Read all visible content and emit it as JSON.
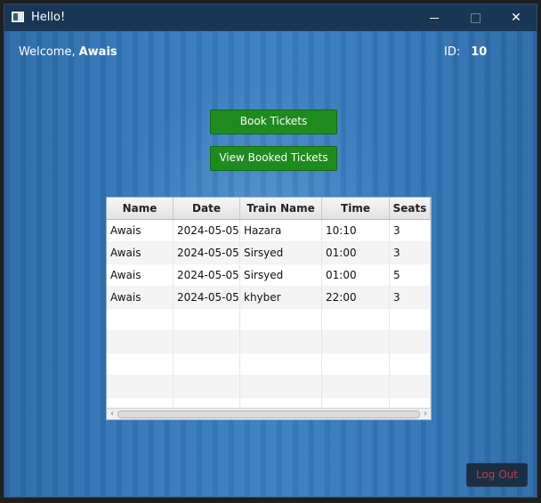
{
  "window": {
    "title": "Hello!"
  },
  "header": {
    "welcome_prefix": "Welcome,",
    "user_name": "Awais",
    "id_label": "ID:",
    "id_value": "10"
  },
  "actions": {
    "book_label": "Book Tickets",
    "view_label": "View Booked Tickets",
    "logout_label": "Log Out"
  },
  "table": {
    "columns": [
      "Name",
      "Date",
      "Train Name",
      "Time",
      "Seats"
    ],
    "rows": [
      [
        "Awais",
        "2024-05-05",
        "Hazara",
        "10:10",
        "3"
      ],
      [
        "Awais",
        "2024-05-05",
        "Sirsyed",
        "01:00",
        "3"
      ],
      [
        "Awais",
        "2024-05-05",
        "Sirsyed",
        "01:00",
        "5"
      ],
      [
        "Awais",
        "2024-05-05",
        "khyber",
        "22:00",
        "3"
      ]
    ]
  },
  "colors": {
    "accent_green": "#1e8b1e",
    "logout_text": "#c03b46",
    "title_bar": "#1a3655"
  }
}
